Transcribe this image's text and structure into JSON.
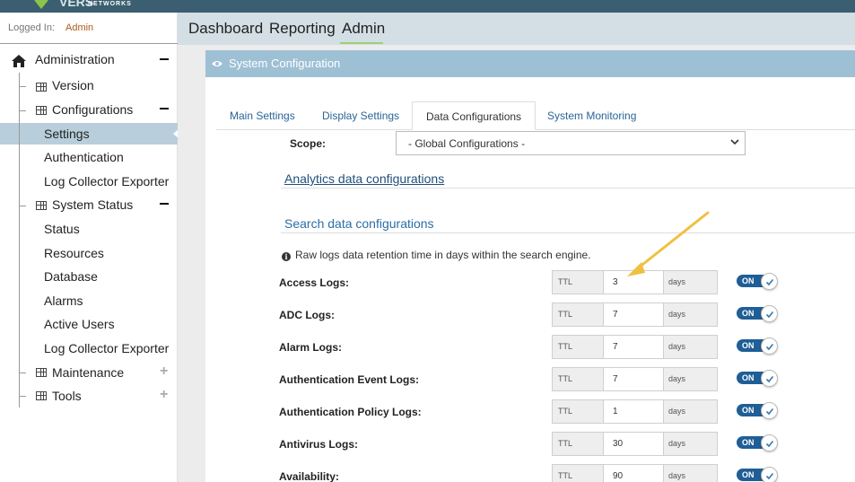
{
  "colors": {
    "accent": "#1f5e96",
    "header_blue": "#9ec0d5",
    "arrow": "#f0c040",
    "active_nav": "#b8cfdb"
  },
  "brand": {
    "logo_sub": "NETWORKS"
  },
  "session": {
    "logged_in_label": "Logged In:",
    "user": "Admin"
  },
  "sidebar": {
    "root": "Administration",
    "items": {
      "version": "Version",
      "configurations": "Configurations",
      "settings": "Settings",
      "authentication": "Authentication",
      "log_collector_exporter_1": "Log Collector Exporter",
      "system_status": "System Status",
      "status": "Status",
      "resources": "Resources",
      "database": "Database",
      "alarms": "Alarms",
      "active_users": "Active Users",
      "log_collector_exporter_2": "Log Collector Exporter",
      "maintenance": "Maintenance",
      "tools": "Tools"
    }
  },
  "mainnav": {
    "dashboard": "Dashboard",
    "reporting": "Reporting",
    "admin": "Admin"
  },
  "panel": {
    "title": "System Configuration"
  },
  "tabs": {
    "main": "Main Settings",
    "display": "Display Settings",
    "data": "Data Configurations",
    "monitoring": "System Monitoring"
  },
  "scope": {
    "label": "Scope:",
    "value": "- Global Configurations -"
  },
  "sections": {
    "analytics": "Analytics data configurations",
    "search": "Search data configurations",
    "info": "Raw logs data retention time in days within the search engine."
  },
  "ttl_prefix": "TTL",
  "ttl_suffix": "days",
  "toggle_on": "ON",
  "rows": [
    {
      "label": "Access Logs:",
      "value": "3"
    },
    {
      "label": "ADC Logs:",
      "value": "7"
    },
    {
      "label": "Alarm Logs:",
      "value": "7"
    },
    {
      "label": "Authentication Event Logs:",
      "value": "7"
    },
    {
      "label": "Authentication Policy Logs:",
      "value": "1"
    },
    {
      "label": "Antivirus Logs:",
      "value": "30"
    },
    {
      "label": "Availability:",
      "value": "90"
    }
  ]
}
